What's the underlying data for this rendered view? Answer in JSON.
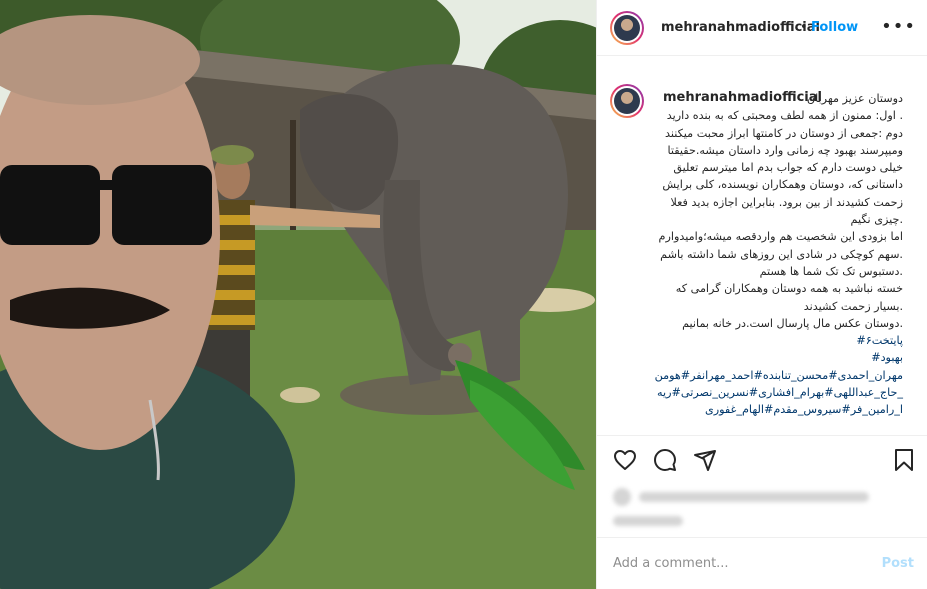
{
  "post": {
    "username": "mehranahmadiofficial",
    "separator": "•",
    "follow_label": "Follow",
    "more_icon": "more-options-icon"
  },
  "caption": {
    "username": "mehranahmadiofficial",
    "lines": [
      "دوستان عزیز مهربان",
      ". اول: ممنون از همه لطف ومحبتی که به بنده دارید",
      "دوم :جمعی از دوستان در کامنتها ابراز محبت میکنند",
      "ومیپرسند بهبود چه زمانی وارد داستان میشه.حقیقتا",
      "خیلی دوست دارم که جواب بدم اما میترسم تعلیق",
      "داستانی که، دوستان وهمکاران نویسنده، کلی برایش",
      "زحمت کشیدند از بین برود. بنابراین اجازه بدید فعلا",
      ".چیزی نگیم",
      "اما بزودی این شخصیت هم واردقصه میشه؛وامیدوارم",
      ".سهم کوچکی در شادی این روزهای شما داشته باشم",
      ".دستبوس تک تک شما ها هستم",
      "خسته نباشید به همه دوستان وهمکاران گرامی که",
      ".بسیار زحمت کشیدند",
      ".دوستان عکس مال پارسال است.در خانه بمانیم"
    ],
    "hashtags": [
      "پایتخت۶#",
      "بهبود#",
      "مهران_احمدی#محسن_تنابنده#احمد_مهرانفر#هومن",
      "_حاج_عبداللهی#بهرام_افشاری#نسرین_نصرتی#ریه",
      "ا_رامین_فر#سیروس_مقدم#الهام_غفوری"
    ]
  },
  "actions": {
    "like_icon": "heart-icon",
    "comment_icon": "comment-icon",
    "share_icon": "share-icon",
    "save_icon": "bookmark-icon"
  },
  "comment": {
    "placeholder": "Add a comment...",
    "post_label": "Post"
  },
  "colors": {
    "accent": "#0095f6",
    "hashtag": "#00376b",
    "post_disabled": "#b2dffc",
    "border": "#efefef"
  }
}
